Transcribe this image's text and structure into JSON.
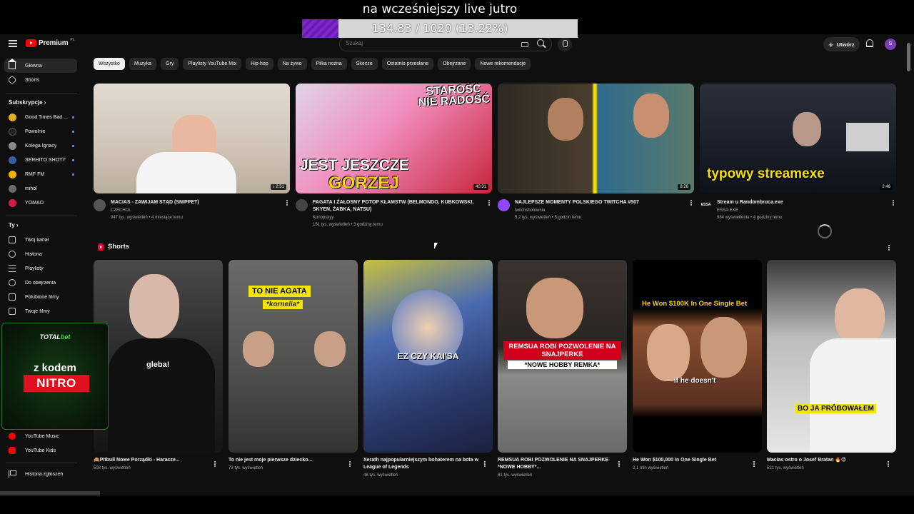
{
  "overlay": {
    "title": "na wcześniejszy live jutro",
    "goal_text": "134.83 / 1020 (13.22%)",
    "goal_fraction": 0.1322
  },
  "header": {
    "logo": "Premium",
    "logo_sup": "PL",
    "search_placeholder": "Szukaj",
    "create_label": "Utwórz",
    "avatar_initial": "S"
  },
  "sidebar": {
    "main": [
      {
        "label": "Główna",
        "icon": "home-icon"
      },
      {
        "label": "Shorts",
        "icon": "shorts-icon"
      }
    ],
    "subs_heading": "Subskrypcje",
    "subs": [
      {
        "label": "Good Times Bad ...",
        "color": "#e0b020"
      },
      {
        "label": "Powolnie",
        "color": "#222222"
      },
      {
        "label": "Kolega Ignacy",
        "color": "#8a8a8a"
      },
      {
        "label": "SERHITO SHOTY",
        "color": "#3a5fa0"
      },
      {
        "label": "RMF FM",
        "color": "#f0b400"
      },
      {
        "label": "mihol",
        "color": "#6b6b6b"
      },
      {
        "label": "YOMAO",
        "color": "#d02040"
      }
    ],
    "you_heading": "Ty",
    "you": [
      {
        "label": "Twój kanał",
        "icon": "account-box-icon"
      },
      {
        "label": "Historia",
        "icon": "history-icon"
      },
      {
        "label": "Playlisty",
        "icon": "playlist-icon"
      },
      {
        "label": "Do obejrzenia",
        "icon": "clock-icon"
      },
      {
        "label": "Polubione filmy",
        "icon": "thumb-up-icon"
      },
      {
        "label": "Twoje filmy",
        "icon": "video-icon"
      }
    ],
    "more": [
      {
        "label": "YouTube Music",
        "icon": "youtube-music-icon"
      },
      {
        "label": "YouTube Kids",
        "icon": "youtube-kids-icon"
      }
    ],
    "report": "Historia zgłoszeń"
  },
  "ad": {
    "brand_a": "TOTAL",
    "brand_b": "bet",
    "line1": "z kodem",
    "code": "NITRO"
  },
  "chips": [
    "Wszystko",
    "Muzyka",
    "Gry",
    "Playlisty YouTube Mix",
    "Hip-hop",
    "Na żywo",
    "Piłka nożna",
    "Skecze",
    "Ostatnio przesłane",
    "Obejrzane",
    "Nowe rekomendacje"
  ],
  "videos": [
    {
      "title": "MACIAS - ZAWIJAM STĄD (SNIPPET)",
      "channel": "CZECHOL",
      "stats": "947 tys. wyświetleń • 4 miesiące temu",
      "duration": "♪ 2:51",
      "thumb_color": "#d8cfc4",
      "avatar": "#555"
    },
    {
      "title": "FAGATA I ŻAŁOSNY POTOP KŁAMSTW (BELMONDO, KUBKOWSKI, SKYEN, ŻABKA, NATSU)",
      "channel": "Konopskyy",
      "stats": "151 tys. wyświetleń • 3 godziny temu",
      "duration": "40:31",
      "thumb_color": "#c8253b",
      "avatar": "#444",
      "caption_top": "STAROŚĆ NIE RADOŚĆ",
      "caption_bottom_a": "JEST JESZCZE",
      "caption_bottom_b": "GORZEJ"
    },
    {
      "title": "NAJLEPSZE MOMENTY POLSKIEGO TWITCHA #507",
      "channel": "twitchshotownia",
      "stats": "5,2 tys. wyświetleń • 5 godzin temu",
      "duration": "8:26",
      "thumb_color": "#3a3f38",
      "avatar": "#9146ff"
    },
    {
      "title": "Stream u Randombruca.exe",
      "channel": "ESSA.EXE",
      "stats": "984 wyświetlenia • 4 godziny temu",
      "duration": "2:46",
      "thumb_color": "#1c2230",
      "avatar": "#111",
      "avatar_text": "ESSA",
      "caption_top": "typowy streamexe"
    }
  ],
  "shorts_heading": "Shorts",
  "shorts": [
    {
      "title": "🙈Pitbull Nowe Porządki - Haracze...",
      "views": "508 tys. wyświetleń",
      "caption": "gleba!",
      "bg": "#2a2a2a",
      "cap_bg": "#111",
      "cap_color": "#fff"
    },
    {
      "title": "To nie jest moje pierwsze dziecko...",
      "views": "73 tys. wyświetleń",
      "caption": "TO NIE AGATA",
      "caption2": "*kornelia*",
      "bg": "#5a5a58",
      "cap_bg": "#f5e400",
      "cap_color": "#000"
    },
    {
      "title": "Xerath najpopularniejszym bohaterem na bota w League of Legends",
      "views": "48 tys. wyświetleń",
      "caption": "EZ CZY KAI'SA",
      "bg": "#3a4a7a",
      "cap_bg": "transparent",
      "cap_color": "#fff"
    },
    {
      "title": "REMSUA ROBI POZWOLENIE NA SNAJPERKE *NOWE HOBBY*...",
      "views": "61 tys. wyświetleń",
      "caption": "REMSUA ROBI POZWOLENIE NA SNAJPERKE",
      "caption2": "*NOWE HOBBY REMKA*",
      "bg": "#3b3330",
      "cap_bg": "#d0001a",
      "cap_color": "#fff"
    },
    {
      "title": "He Won $100,000 In One Single Bet",
      "views": "2,1 mln wyświetleń",
      "caption": "He Won $100K In One Single Bet",
      "caption2": "If he doesn't",
      "bg": "#6a4030",
      "cap_bg": "transparent",
      "cap_color": "#ffd400"
    },
    {
      "title": "Macias ostro o Josef Bratan 🔥😡",
      "views": "521 tys. wyświetleń",
      "caption": "BO JA PRÓBOWAŁEM",
      "bg": "#dcdcdc",
      "cap_bg": "#f5e400",
      "cap_color": "#000"
    }
  ]
}
